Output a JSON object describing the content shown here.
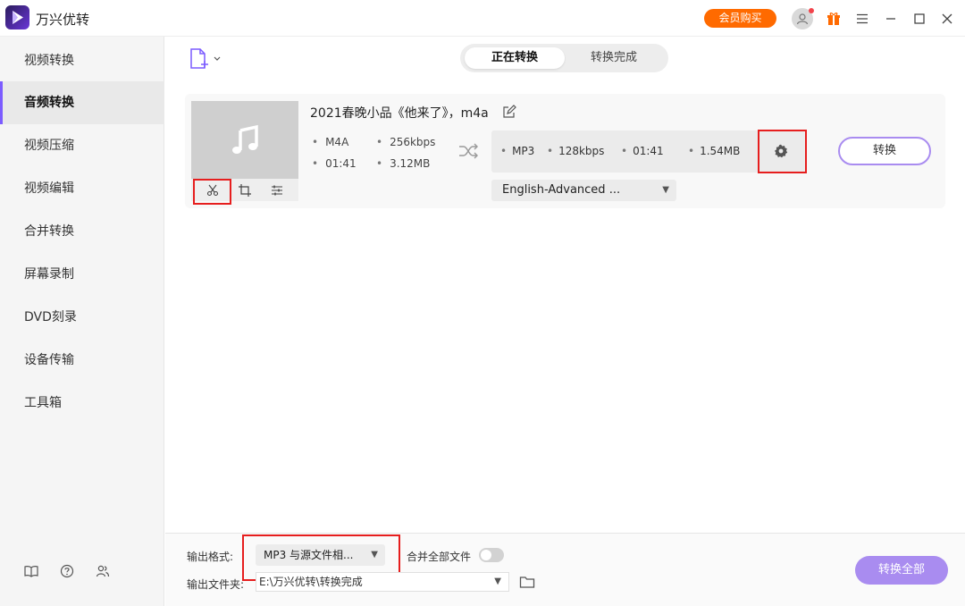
{
  "app": {
    "title": "万兴优转",
    "vip_label": "会员购买"
  },
  "sidebar": {
    "items": [
      {
        "label": "视频转换"
      },
      {
        "label": "音频转换",
        "active": true
      },
      {
        "label": "视频压缩"
      },
      {
        "label": "视频编辑"
      },
      {
        "label": "合并转换"
      },
      {
        "label": "屏幕录制"
      },
      {
        "label": "DVD刻录"
      },
      {
        "label": "设备传输"
      },
      {
        "label": "工具箱"
      }
    ]
  },
  "tabs": {
    "converting": "正在转换",
    "completed": "转换完成"
  },
  "file": {
    "name": "2021春晚小品《他来了》，m4a",
    "source": {
      "format": "M4A",
      "bitrate": "256kbps",
      "duration": "01:41",
      "size": "3.12MB"
    },
    "output": {
      "format": "MP3",
      "bitrate": "128kbps",
      "duration": "01:41",
      "size": "1.54MB"
    },
    "audio_track": "English-Advanced ...",
    "convert_label": "转换"
  },
  "bottom": {
    "output_format_label": "输出格式:",
    "output_format_value": "MP3 与源文件相...",
    "merge_label": "合并全部文件",
    "merge_enabled": false,
    "output_folder_label": "输出文件夹:",
    "output_folder_value": "E:\\万兴优转\\转换完成",
    "convert_all_label": "转换全部"
  },
  "colors": {
    "accent": "#a98cf0",
    "vip": "#ff6a00",
    "highlight": "#e61e1e"
  }
}
